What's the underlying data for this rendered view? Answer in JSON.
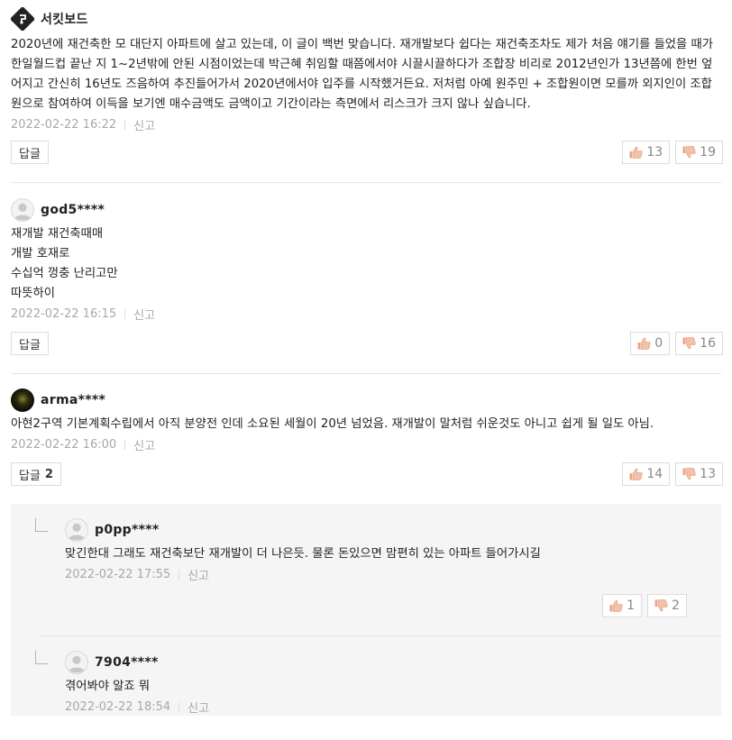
{
  "comments": [
    {
      "username": "서킷보드",
      "text": "2020년에 재건축한 모 대단지 아파트에 살고 있는데, 이 글이 백번 맞습니다. 재개발보다 쉽다는 재건축조차도 제가 처음 얘기를 들었을 때가 한일월드컵 끝난 지 1~2년밖에 안된 시점이었는데 박근혜 취임할 때쯤에서야 시끌시끌하다가 조합장 비리로 2012년인가 13년쯤에 한번 엎어지고 간신히 16년도 즈음하여 추진들어가서 2020년에서야 입주를 시작했거든요. 저처럼 아예 원주민 + 조합원이면 모를까 외지인이 조합원으로 참여하여 이득을 보기엔 매수금액도 금액이고 기간이라는 측면에서 리스크가 크지 않나 싶습니다.",
      "date": "2022-02-22 16:22",
      "report": "신고",
      "reply_label": "답글",
      "reply_count": "",
      "likes": "13",
      "dislikes": "19"
    },
    {
      "username": "god5****",
      "text": "재개발 재건축때매\n개발 호재로\n수십억 껑충 난리고만\n따뜻하이",
      "date": "2022-02-22 16:15",
      "report": "신고",
      "reply_label": "답글",
      "reply_count": "",
      "likes": "0",
      "dislikes": "16"
    },
    {
      "username": "arma****",
      "text": "아현2구역 기본계획수립에서 아직 분양전 인데 소요된 세월이 20년 넘었음. 재개발이 말처럼 쉬운것도 아니고 쉽게 될 일도 아님.",
      "date": "2022-02-22 16:00",
      "report": "신고",
      "reply_label": "답글",
      "reply_count": "2",
      "likes": "14",
      "dislikes": "13"
    }
  ],
  "replies": [
    {
      "username": "p0pp****",
      "text": "맞긴한대 그래도 재건축보단 재개발이 더 나은듯. 물론 돈있으면 맘편히 있는 아파트 들어가시길",
      "date": "2022-02-22 17:55",
      "report": "신고",
      "likes": "1",
      "dislikes": "2"
    },
    {
      "username": "7904****",
      "text": "겪어봐야 알죠 뭐",
      "date": "2022-02-22 18:54",
      "report": "신고"
    }
  ],
  "colors": {
    "meta": "#a8a8a8",
    "border": "#dcdcdc",
    "reply_bg": "#f5f5f5",
    "icon": "#e8a58a"
  },
  "icons": {
    "like": "thumbs-up-icon",
    "dislike": "thumbs-down-icon",
    "branch": "reply-branch-icon",
    "logo": "circuit-board-logo-icon",
    "avatar": "default-avatar-icon"
  }
}
